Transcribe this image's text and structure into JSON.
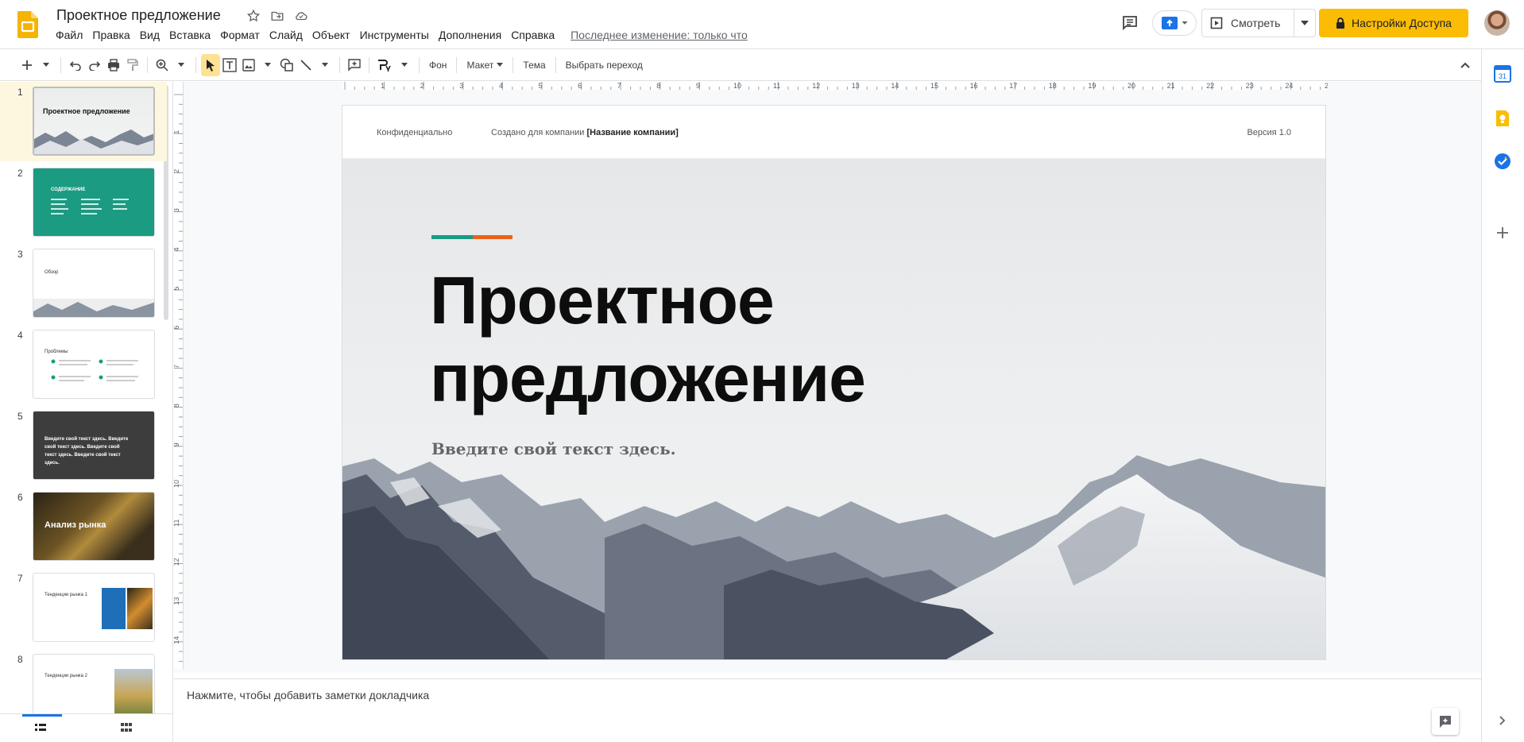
{
  "app": {
    "title": "Проектное предложение",
    "last_edit": "Последнее изменение: только что"
  },
  "menu": [
    "Файл",
    "Правка",
    "Вид",
    "Вставка",
    "Формат",
    "Слайд",
    "Объект",
    "Инструменты",
    "Дополнения",
    "Справка"
  ],
  "header": {
    "view_label": "Смотреть",
    "share_label": "Настройки Доступа"
  },
  "toolbar": {
    "background": "Фон",
    "layout": "Макет",
    "theme": "Тема",
    "transition": "Выбрать переход"
  },
  "rulers": {
    "h": [
      "1",
      "2",
      "3",
      "4",
      "5",
      "6",
      "7",
      "8",
      "9",
      "10",
      "11",
      "12",
      "13",
      "14",
      "15",
      "16",
      "17",
      "18",
      "19",
      "20",
      "21",
      "22",
      "23",
      "24",
      "25"
    ],
    "v": [
      "1",
      "2",
      "3",
      "4",
      "5",
      "6",
      "7",
      "8",
      "9",
      "10",
      "11",
      "12",
      "13",
      "14"
    ]
  },
  "filmstrip": [
    {
      "num": "1",
      "title": "Проектное предложение"
    },
    {
      "num": "2",
      "title": "СОДЕРЖАНИЕ"
    },
    {
      "num": "3",
      "title": "Обзор"
    },
    {
      "num": "4",
      "title": "Проблемы"
    },
    {
      "num": "5",
      "title": "Введите свой текст здесь. Введите свой текст здесь. Введите свой текст здесь. Введите свой текст здесь."
    },
    {
      "num": "6",
      "title": "Анализ рынка"
    },
    {
      "num": "7",
      "title": "Тенденции рынка 1"
    },
    {
      "num": "8",
      "title": "Тенденции рынка 2"
    }
  ],
  "slide": {
    "header_left": "Конфиденциально",
    "header_made": "Создано для компании ",
    "header_company": "[Название компании]",
    "header_right": "Версия 1.0",
    "title_line1": "Проектное",
    "title_line2": "предложение",
    "subtitle": "Введите свой текст здесь."
  },
  "notes": {
    "placeholder": "Нажмите, чтобы добавить заметки докладчика"
  },
  "colors": {
    "accent_green": "#1a9b82",
    "accent_orange": "#e8641b",
    "share_yellow": "#fbbc04",
    "selection": "#fef7e0"
  }
}
